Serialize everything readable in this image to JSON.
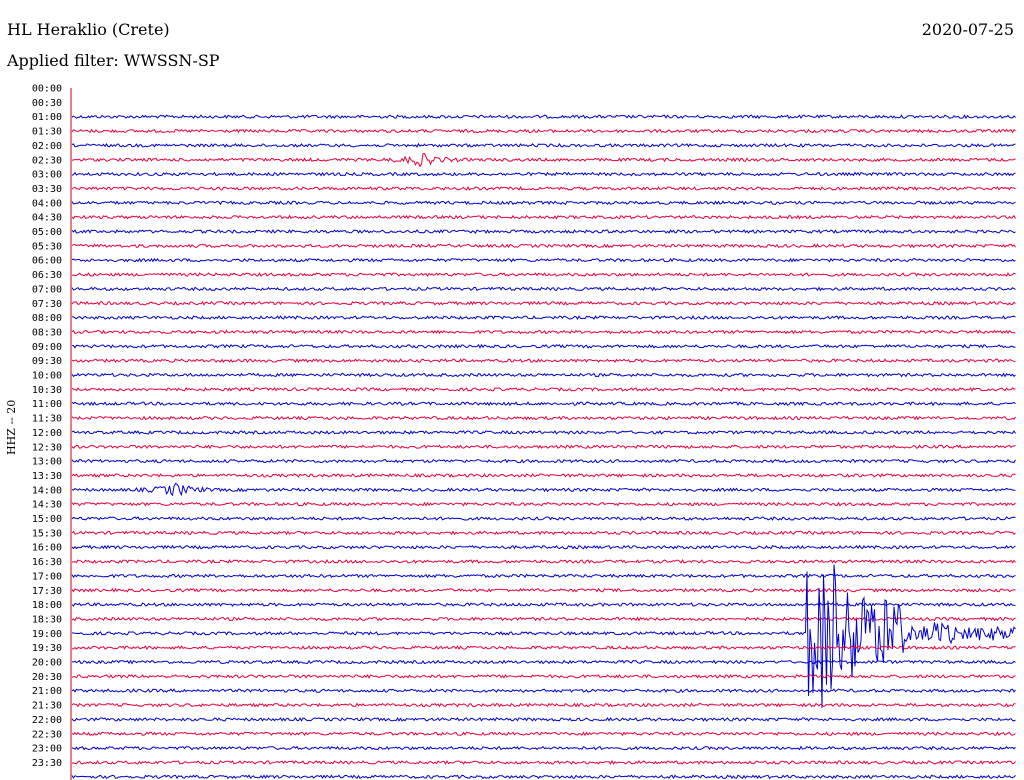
{
  "header": {
    "station": "HL Heraklio (Crete)",
    "date": "2020-07-25",
    "filter": "Applied filter: WWSSN-SP"
  },
  "colors": {
    "blue": "#0000cc",
    "red": "#e8003c",
    "axis": "#cc0000"
  },
  "chart_data": {
    "type": "line",
    "title": "HL Heraklio (Crete)",
    "ylabel": "HHZ -- 20",
    "row_interval_minutes": 30,
    "tick_labels": [
      "00:00",
      "00:30",
      "01:00",
      "01:30",
      "02:00",
      "02:30",
      "03:00",
      "03:30",
      "04:00",
      "04:30",
      "05:00",
      "05:30",
      "06:00",
      "06:30",
      "07:00",
      "07:30",
      "08:00",
      "08:30",
      "09:00",
      "09:30",
      "10:00",
      "10:30",
      "11:00",
      "11:30",
      "12:00",
      "12:30",
      "13:00",
      "13:30",
      "14:00",
      "14:30",
      "15:00",
      "15:30",
      "16:00",
      "16:30",
      "17:00",
      "17:30",
      "18:00",
      "18:30",
      "19:00",
      "19:30",
      "20:00",
      "20:30",
      "21:00",
      "21:30",
      "22:00",
      "22:30",
      "23:00",
      "23:30"
    ],
    "trace_start": "01:00",
    "events": [
      {
        "row": "02:30",
        "position": 0.37,
        "amplitude": "small"
      },
      {
        "row": "14:00",
        "position": 0.11,
        "amplitude": "small"
      },
      {
        "row": "19:00",
        "position": 0.79,
        "amplitude": "large"
      }
    ]
  }
}
